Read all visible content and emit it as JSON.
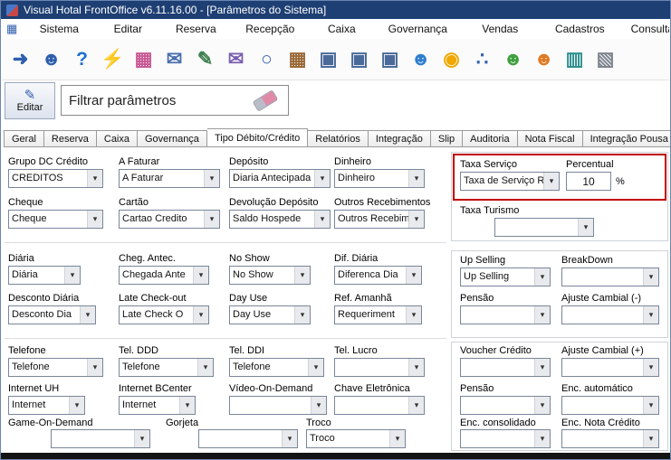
{
  "colors": {
    "titlebar_bg": "#1e3f73",
    "highlight": "#c00000"
  },
  "window": {
    "title": "Visual Hotal FrontOffice v6.11.16.00 - [Parâmetros do Sistema]"
  },
  "menu": {
    "items": [
      "Sistema",
      "Editar",
      "Reserva",
      "Recepção",
      "Caixa",
      "Governança",
      "Vendas",
      "Cadastros",
      "Consulta"
    ]
  },
  "toolbar": {
    "icons": [
      {
        "name": "exit-icon",
        "glyph": "➜",
        "color": "#2e5fad"
      },
      {
        "name": "guest-card-icon",
        "glyph": "☻",
        "color": "#2e5fad"
      },
      {
        "name": "help-icon",
        "glyph": "?",
        "color": "#1f6fd0"
      },
      {
        "name": "lightning-icon",
        "glyph": "⚡",
        "color": "#f0a800"
      },
      {
        "name": "structure-icon",
        "glyph": "▦",
        "color": "#c85a96"
      },
      {
        "name": "mail-icon",
        "glyph": "✉",
        "color": "#4a6fae"
      },
      {
        "name": "invoice-edit-icon",
        "glyph": "✎",
        "color": "#3f7f4f"
      },
      {
        "name": "send-mail-icon",
        "glyph": "✉",
        "color": "#7a5fae"
      },
      {
        "name": "search-icon",
        "glyph": "○",
        "color": "#2e5fad"
      },
      {
        "name": "calendar-icon",
        "glyph": "▦",
        "color": "#9a6a3a"
      },
      {
        "name": "room-single-icon",
        "glyph": "▣",
        "color": "#4a6a9a"
      },
      {
        "name": "room-double-icon",
        "glyph": "▣",
        "color": "#4a6a9a"
      },
      {
        "name": "room-status-icon",
        "glyph": "▣",
        "color": "#4a6a9a"
      },
      {
        "name": "guests-group-icon",
        "glyph": "☻",
        "color": "#2e7fd0"
      },
      {
        "name": "bell-icon",
        "glyph": "◉",
        "color": "#f0a800"
      },
      {
        "name": "footprints-icon",
        "glyph": "∴",
        "color": "#2e5fad"
      },
      {
        "name": "add-guest-icon",
        "glyph": "☻",
        "color": "#3f9f3f"
      },
      {
        "name": "guest-orange-icon",
        "glyph": "☻",
        "color": "#e07820"
      },
      {
        "name": "screen-report-icon",
        "glyph": "▥",
        "color": "#2f8f8f"
      },
      {
        "name": "cash-register-icon",
        "glyph": "▧",
        "color": "#7f8690"
      }
    ]
  },
  "edit_button": {
    "label": "Editar",
    "glyph": "✎"
  },
  "filter": {
    "value": "Filtrar parâmetros"
  },
  "tabs": {
    "items": [
      "Geral",
      "Reserva",
      "Caixa",
      "Governança",
      "Tipo Débito/Crédito",
      "Relatórios",
      "Integração",
      "Slip",
      "Auditoria",
      "Nota Fiscal",
      "Integração Pousa"
    ],
    "active": "Tipo Débito/Crédito"
  },
  "icons": {
    "chevron": "▾"
  },
  "fields": {
    "grupo_dc": {
      "label": "Grupo DC Crédito",
      "value": "CREDITOS"
    },
    "a_faturar": {
      "label": "A Faturar",
      "value": "A Faturar"
    },
    "deposito": {
      "label": "Depósito",
      "value": "Diaria Antecipada"
    },
    "dinheiro": {
      "label": "Dinheiro",
      "value": "Dinheiro"
    },
    "taxa_servico": {
      "label": "Taxa Serviço",
      "value": "Taxa de Serviço RE"
    },
    "percentual": {
      "label": "Percentual",
      "value": "10",
      "suffix": "%"
    },
    "cheque": {
      "label": "Cheque",
      "value": "Cheque"
    },
    "cartao": {
      "label": "Cartão",
      "value": "Cartao Credito"
    },
    "devolucao_deposito": {
      "label": "Devolução Depósito",
      "value": "Saldo Hospede"
    },
    "outros_recebimentos": {
      "label": "Outros Recebimentos",
      "value": "Outros Recebimen"
    },
    "taxa_turismo": {
      "label": "Taxa Turismo",
      "value": ""
    },
    "diaria": {
      "label": "Diária",
      "value": "Diária"
    },
    "cheg_antec": {
      "label": "Cheg. Antec.",
      "value": "Chegada Ante"
    },
    "no_show": {
      "label": "No Show",
      "value": "No Show"
    },
    "dif_diaria": {
      "label": "Dif. Diária",
      "value": "Diferenca Dia"
    },
    "up_selling": {
      "label": "Up Selling",
      "value": "Up Selling"
    },
    "breakdown": {
      "label": "BreakDown",
      "value": ""
    },
    "desconto_diaria": {
      "label": "Desconto Diária",
      "value": "Desconto Dia"
    },
    "late_checkout": {
      "label": "Late Check-out",
      "value": "Late Check O"
    },
    "day_use": {
      "label": "Day Use",
      "value": "Day Use"
    },
    "ref_amanha": {
      "label": "Ref. Amanhã",
      "value": "Requeriment"
    },
    "pensao_mid": {
      "label": "Pensão",
      "value": ""
    },
    "ajuste_cambial_menos": {
      "label": "Ajuste Cambial (-)",
      "value": ""
    },
    "telefone": {
      "label": "Telefone",
      "value": "Telefone"
    },
    "tel_ddd": {
      "label": "Tel. DDD",
      "value": "Telefone"
    },
    "tel_ddi": {
      "label": "Tel. DDI",
      "value": "Telefone"
    },
    "tel_lucro": {
      "label": "Tel. Lucro",
      "value": ""
    },
    "voucher_credito": {
      "label": "Voucher Crédito",
      "value": ""
    },
    "ajuste_cambial_mais": {
      "label": "Ajuste Cambial (+)",
      "value": ""
    },
    "internet_uh": {
      "label": "Internet UH",
      "value": "Internet"
    },
    "internet_bcenter": {
      "label": "Internet BCenter",
      "value": "Internet"
    },
    "video_on_demand": {
      "label": "Vídeo-On-Demand",
      "value": ""
    },
    "chave_eletronica": {
      "label": "Chave Eletrônica",
      "value": ""
    },
    "pensao_baixo": {
      "label": "Pensão",
      "value": ""
    },
    "enc_automatico": {
      "label": "Enc. automático",
      "value": ""
    },
    "game_on_demand": {
      "label": "Game-On-Demand",
      "value": ""
    },
    "gorjeta": {
      "label": "Gorjeta",
      "value": ""
    },
    "troco": {
      "label": "Troco",
      "value": "Troco"
    },
    "enc_consolidado": {
      "label": "Enc. consolidado",
      "value": ""
    },
    "enc_nota_credito": {
      "label": "Enc. Nota Crédito",
      "value": ""
    }
  }
}
